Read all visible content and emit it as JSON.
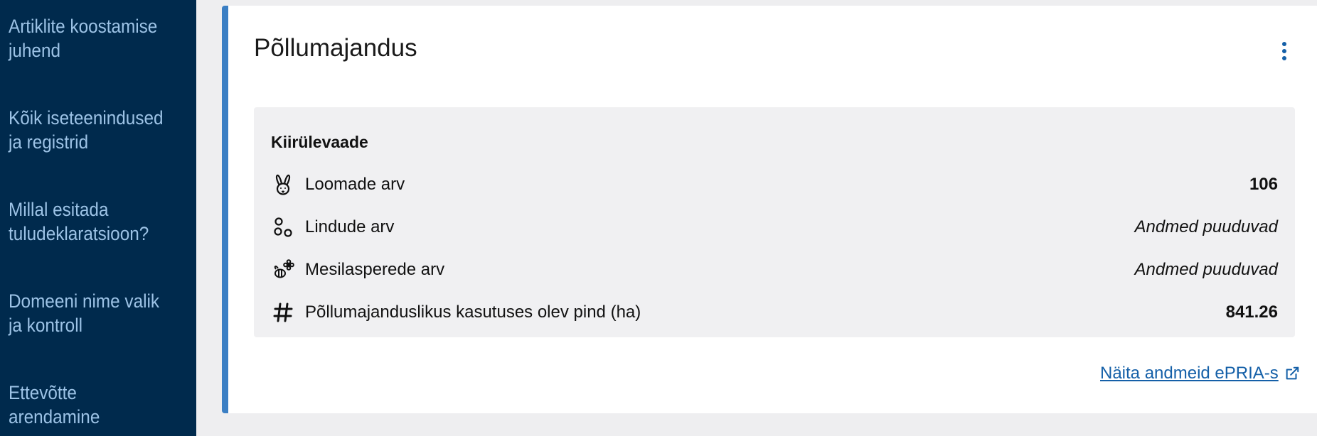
{
  "sidebar": {
    "items": [
      {
        "label": "Artiklite koostamise juhend"
      },
      {
        "label": "Kõik iseteenindused ja registrid"
      },
      {
        "label": "Millal esitada tuludeklaratsioon?"
      },
      {
        "label": "Domeeni nime valik ja kontroll"
      },
      {
        "label": "Ettevõtte arendamine"
      }
    ]
  },
  "card": {
    "title": "Põllumajandus",
    "overview": {
      "title": "Kiirülevaade",
      "rows": [
        {
          "icon": "rabbit-icon",
          "label": "Loomade arv",
          "value": "106"
        },
        {
          "icon": "birds-icon",
          "label": "Lindude arv",
          "value": "Andmed puuduvad"
        },
        {
          "icon": "bee-flower-icon",
          "label": "Mesilasperede arv",
          "value": "Andmed puuduvad"
        },
        {
          "icon": "hash-icon",
          "label": "Põllumajanduslikus kasutuses olev pind (ha)",
          "value": "841.26"
        }
      ]
    },
    "link_label": "Näita andmeid ePRIA-s"
  },
  "colors": {
    "sidebar_bg": "#002a4d",
    "sidebar_text": "#9dc3e6",
    "accent": "#3b7fc4",
    "link": "#1560a8"
  }
}
